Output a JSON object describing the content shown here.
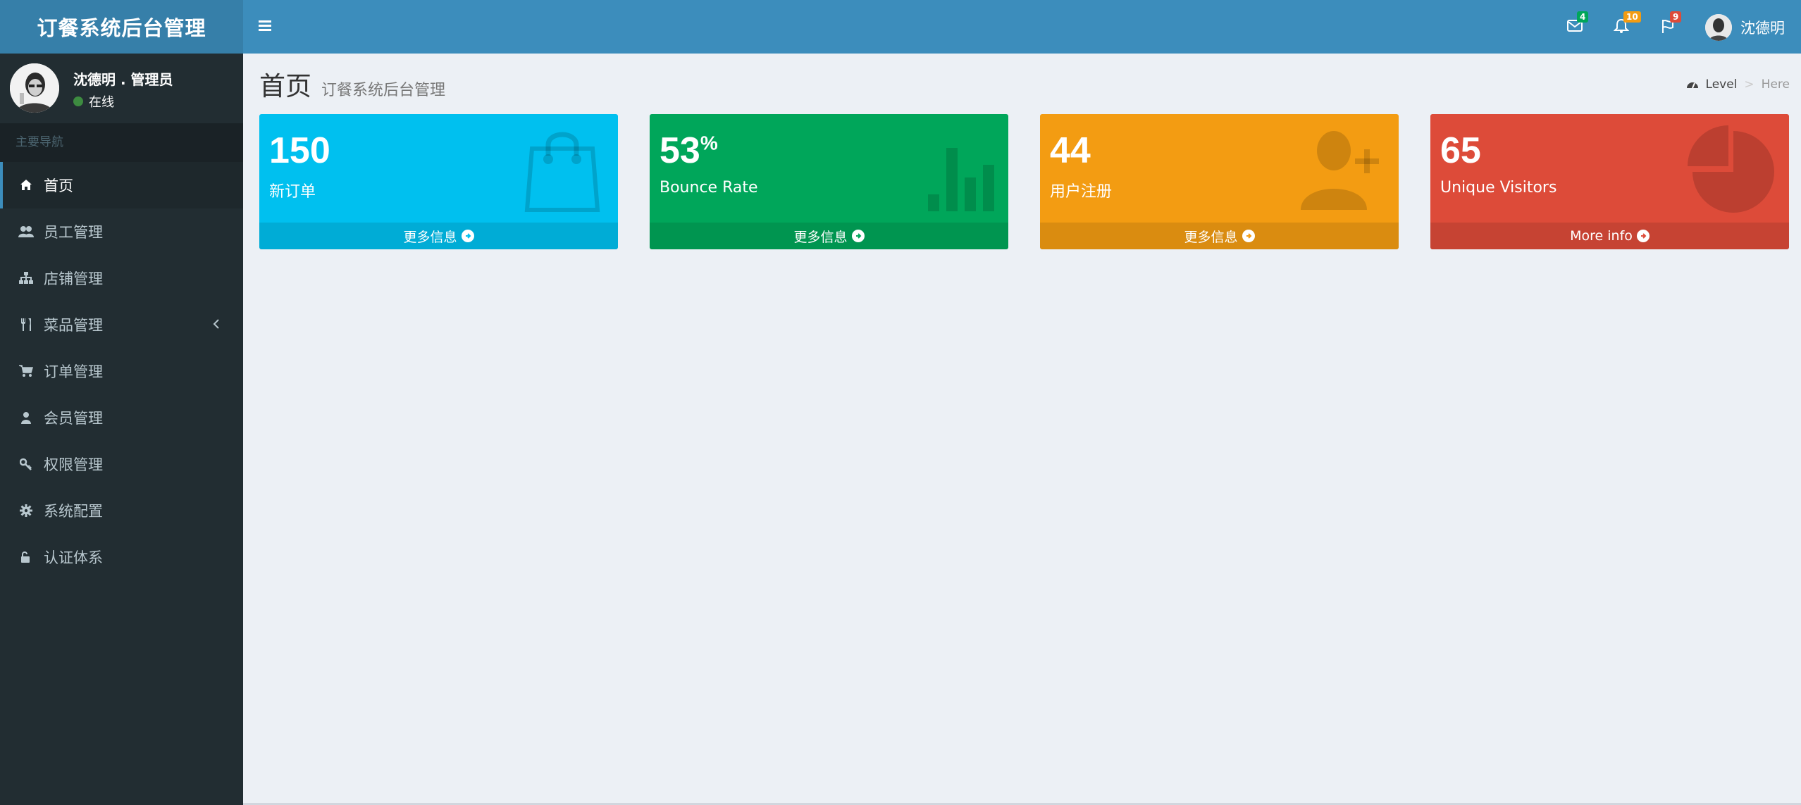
{
  "header": {
    "logo": "订餐系统后台管理",
    "messages_badge": "4",
    "notifications_badge": "10",
    "tasks_badge": "9",
    "user_name": "沈德明"
  },
  "sidebar": {
    "user_name": "沈德明 . 管理员",
    "status": "在线",
    "nav_header": "主要导航",
    "items": [
      {
        "label": "首页",
        "icon": "home-icon"
      },
      {
        "label": "员工管理",
        "icon": "users-icon"
      },
      {
        "label": "店铺管理",
        "icon": "sitemap-icon"
      },
      {
        "label": "菜品管理",
        "icon": "cutlery-icon"
      },
      {
        "label": "订单管理",
        "icon": "cart-icon"
      },
      {
        "label": "会员管理",
        "icon": "user-icon"
      },
      {
        "label": "权限管理",
        "icon": "key-icon"
      },
      {
        "label": "系统配置",
        "icon": "gear-icon"
      },
      {
        "label": "认证体系",
        "icon": "unlock-icon"
      }
    ]
  },
  "content": {
    "title": "首页",
    "subtitle": "订餐系统后台管理",
    "breadcrumb_level": "Level",
    "breadcrumb_sep": ">",
    "breadcrumb_here": "Here"
  },
  "boxes": [
    {
      "value": "150",
      "suffix": "",
      "label": "新订单",
      "footer": "更多信息",
      "color": "#00c0ef",
      "icon": "shopping-bag-icon"
    },
    {
      "value": "53",
      "suffix": "%",
      "label": "Bounce Rate",
      "footer": "更多信息",
      "color": "#00a65a",
      "icon": "bar-chart-icon"
    },
    {
      "value": "44",
      "suffix": "",
      "label": "用户注册",
      "footer": "更多信息",
      "color": "#f39c12",
      "icon": "user-plus-icon"
    },
    {
      "value": "65",
      "suffix": "",
      "label": "Unique Visitors",
      "footer": "More info",
      "color": "#dd4b39",
      "icon": "pie-chart-icon"
    }
  ]
}
